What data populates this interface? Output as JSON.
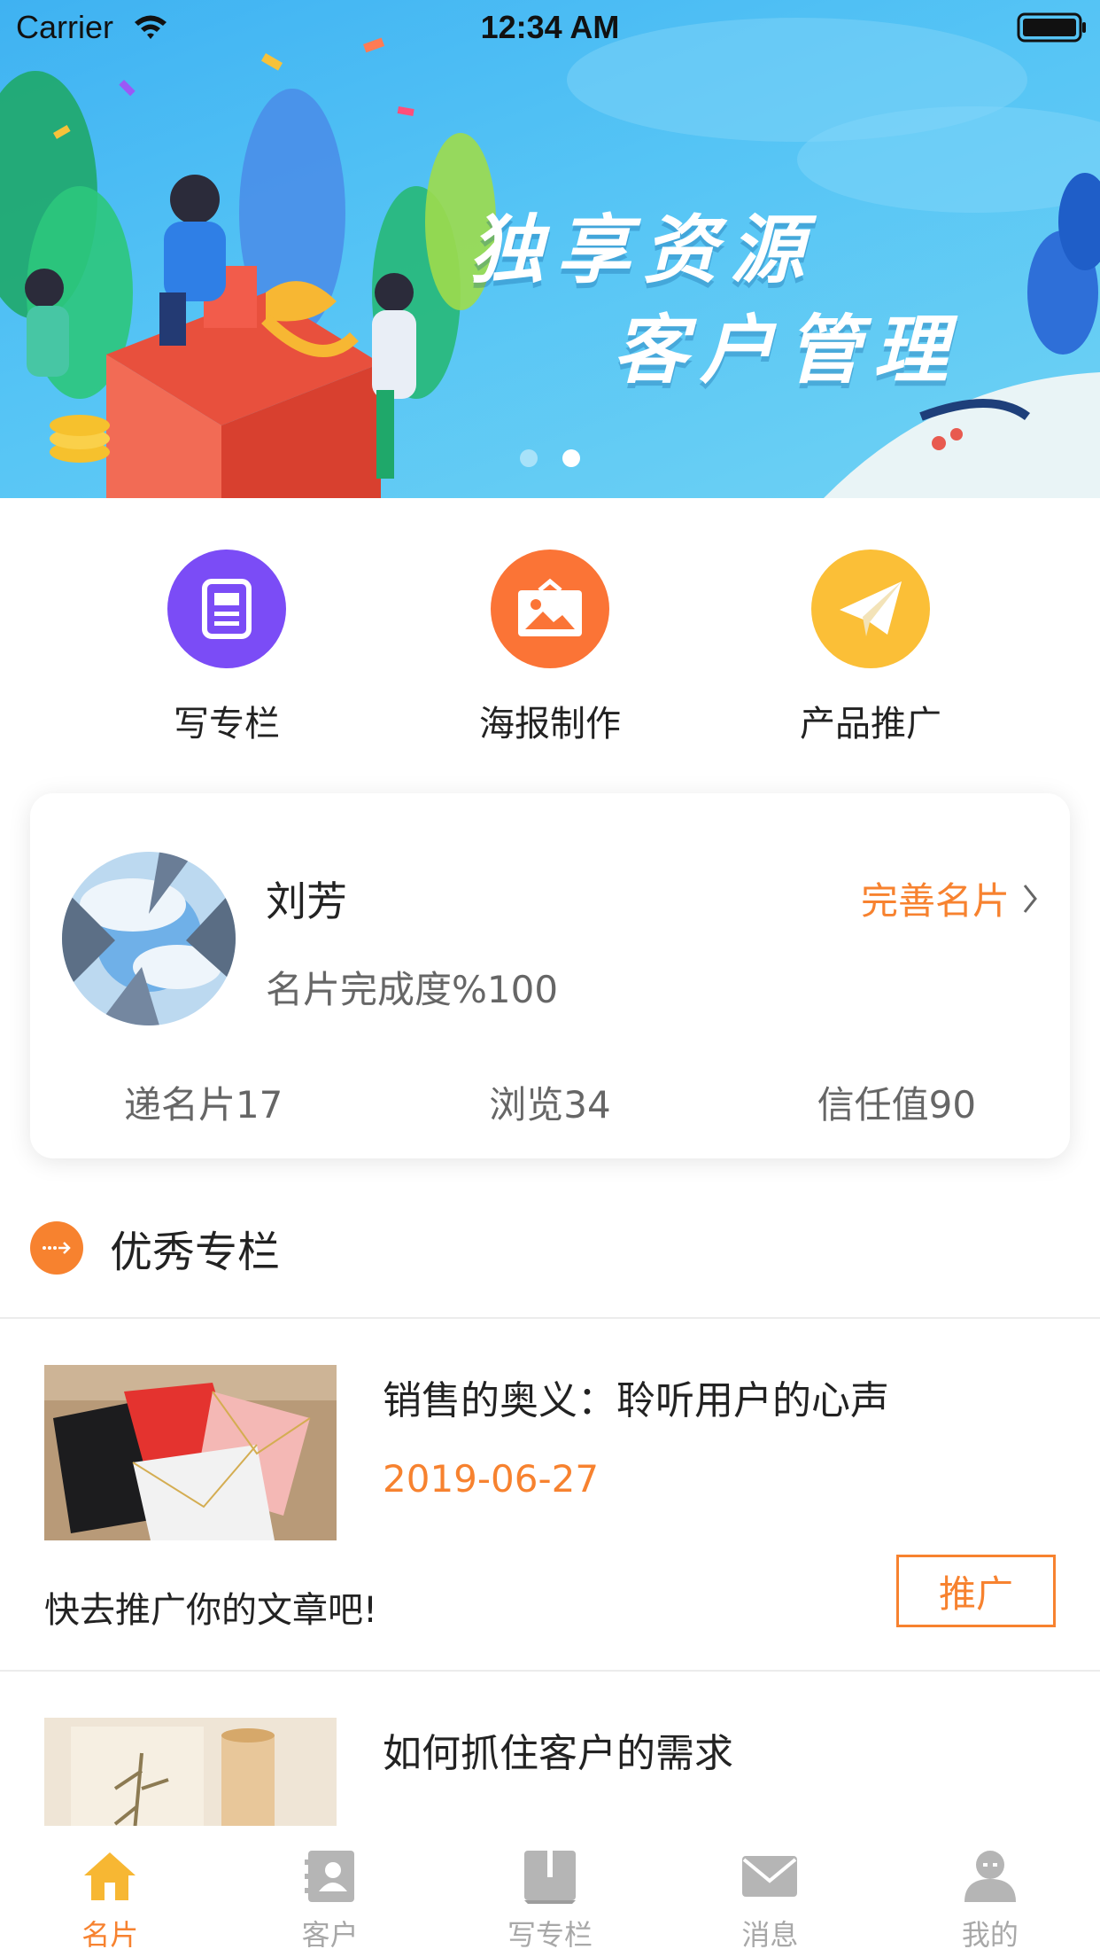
{
  "status_bar": {
    "carrier": "Carrier",
    "time": "12:34 AM"
  },
  "banner": {
    "line1": "独享资源",
    "line2": "客户管理",
    "page_count": 2,
    "active_page": 2
  },
  "quick_actions": [
    {
      "label": "写专栏",
      "icon": "document-icon",
      "color": "#7b4cf6"
    },
    {
      "label": "海报制作",
      "icon": "poster-icon",
      "color": "#fb7436"
    },
    {
      "label": "产品推广",
      "icon": "paper-plane-icon",
      "color": "#fbbf37"
    }
  ],
  "profile": {
    "name": "刘芳",
    "complete_link": "完善名片",
    "completion": "名片完成度%100",
    "stats": {
      "cards_sent": "递名片17",
      "views": "浏览34",
      "trust": "信任值90"
    }
  },
  "section": {
    "title": "优秀专栏"
  },
  "articles": [
    {
      "title": "销售的奥义：聆听用户的心声",
      "date": "2019-06-27",
      "hint": "快去推广你的文章吧!",
      "action": "推广"
    },
    {
      "title": "如何抓住客户的需求"
    }
  ],
  "tabbar": [
    {
      "label": "名片",
      "icon": "home-icon",
      "active": true
    },
    {
      "label": "客户",
      "icon": "contacts-icon",
      "active": false
    },
    {
      "label": "写专栏",
      "icon": "book-icon",
      "active": false
    },
    {
      "label": "消息",
      "icon": "mail-icon",
      "active": false
    },
    {
      "label": "我的",
      "icon": "user-icon",
      "active": false
    }
  ],
  "colors": {
    "accent": "#f7822f",
    "tab_inactive": "#a8a8a8",
    "banner": "#4bbdf4"
  }
}
